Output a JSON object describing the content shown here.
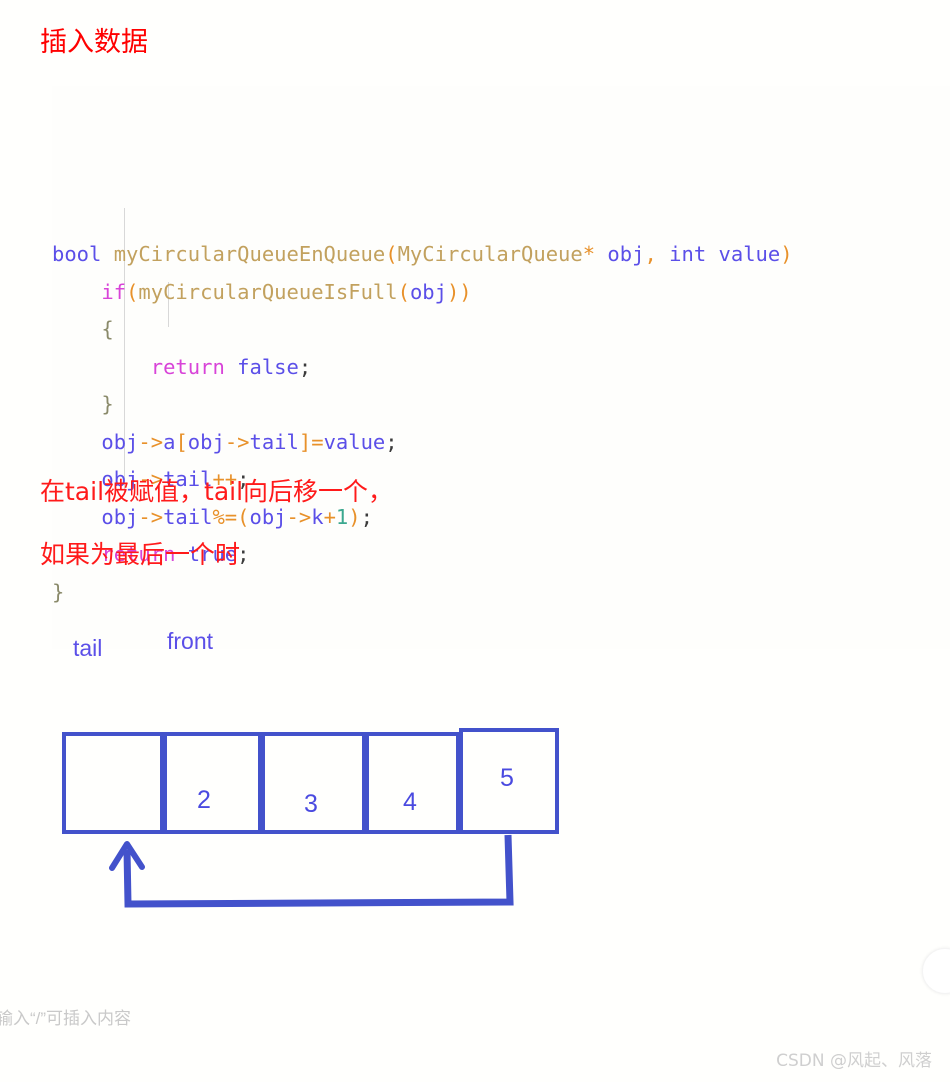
{
  "document": {
    "title": "插入数据",
    "title_color": "#FF0000"
  },
  "code": {
    "language": "c",
    "background": "#FEFEFC",
    "lines": [
      {
        "indent": 0,
        "tokens": [
          {
            "t": "bool",
            "c": "type"
          },
          {
            "t": " ",
            "c": "plain"
          },
          {
            "t": "myCircularQueueEnQueue",
            "c": "fn"
          },
          {
            "t": "(",
            "c": "punc"
          },
          {
            "t": "MyCircularQueue",
            "c": "fn"
          },
          {
            "t": "*",
            "c": "punc"
          },
          {
            "t": " ",
            "c": "plain"
          },
          {
            "t": "obj",
            "c": "var"
          },
          {
            "t": ",",
            "c": "punc"
          },
          {
            "t": " ",
            "c": "plain"
          },
          {
            "t": "int",
            "c": "type"
          },
          {
            "t": " ",
            "c": "plain"
          },
          {
            "t": "value",
            "c": "var"
          },
          {
            "t": ")",
            "c": "punc"
          }
        ]
      },
      {
        "indent": 1,
        "tokens": [
          {
            "t": "if",
            "c": "kw"
          },
          {
            "t": "(",
            "c": "punc"
          },
          {
            "t": "myCircularQueueIsFull",
            "c": "fn"
          },
          {
            "t": "(",
            "c": "punc"
          },
          {
            "t": "obj",
            "c": "var"
          },
          {
            "t": "))",
            "c": "punc"
          }
        ]
      },
      {
        "indent": 1,
        "tokens": [
          {
            "t": "{",
            "c": "brace"
          }
        ]
      },
      {
        "indent": 2,
        "tokens": [
          {
            "t": "return",
            "c": "kw"
          },
          {
            "t": " ",
            "c": "plain"
          },
          {
            "t": "false",
            "c": "lit"
          },
          {
            "t": ";",
            "c": "plain"
          }
        ]
      },
      {
        "indent": 1,
        "tokens": [
          {
            "t": "}",
            "c": "brace"
          }
        ]
      },
      {
        "indent": 1,
        "tokens": [
          {
            "t": "obj",
            "c": "var"
          },
          {
            "t": "->",
            "c": "punc"
          },
          {
            "t": "a",
            "c": "var"
          },
          {
            "t": "[",
            "c": "punc"
          },
          {
            "t": "obj",
            "c": "var"
          },
          {
            "t": "->",
            "c": "punc"
          },
          {
            "t": "tail",
            "c": "var"
          },
          {
            "t": "]",
            "c": "punc"
          },
          {
            "t": "=",
            "c": "punc"
          },
          {
            "t": "value",
            "c": "var"
          },
          {
            "t": ";",
            "c": "plain"
          }
        ]
      },
      {
        "indent": 1,
        "tokens": [
          {
            "t": "obj",
            "c": "var"
          },
          {
            "t": "->",
            "c": "punc"
          },
          {
            "t": "tail",
            "c": "var"
          },
          {
            "t": "++",
            "c": "punc"
          },
          {
            "t": ";",
            "c": "plain"
          }
        ]
      },
      {
        "indent": 1,
        "tokens": [
          {
            "t": "obj",
            "c": "var"
          },
          {
            "t": "->",
            "c": "punc"
          },
          {
            "t": "tail",
            "c": "var"
          },
          {
            "t": "%=",
            "c": "punc"
          },
          {
            "t": "(",
            "c": "punc"
          },
          {
            "t": "obj",
            "c": "var"
          },
          {
            "t": "->",
            "c": "punc"
          },
          {
            "t": "k",
            "c": "var"
          },
          {
            "t": "+",
            "c": "punc"
          },
          {
            "t": "1",
            "c": "num"
          },
          {
            "t": ")",
            "c": "punc"
          },
          {
            "t": ";",
            "c": "plain"
          }
        ]
      },
      {
        "indent": 1,
        "tokens": [
          {
            "t": "return",
            "c": "kw"
          },
          {
            "t": " ",
            "c": "plain"
          },
          {
            "t": "true",
            "c": "lit"
          },
          {
            "t": ";",
            "c": "plain"
          }
        ]
      },
      {
        "indent": 0,
        "tokens": [
          {
            "t": "}",
            "c": "brace"
          }
        ]
      }
    ]
  },
  "annotations": {
    "line1": "在tail被赋值，tail向后移一个，",
    "line2": "如果为最后一个时",
    "color": "#FF1A1A"
  },
  "diagram": {
    "pointers": {
      "tail": "tail",
      "front": "front"
    },
    "pointer_color": "#5B4FE8",
    "box_color": "#4352CB",
    "cells": [
      {
        "value": ""
      },
      {
        "value": "2"
      },
      {
        "value": "3"
      },
      {
        "value": "4"
      },
      {
        "value": "5"
      }
    ]
  },
  "editor": {
    "placeholder": "输入“/”可插入内容"
  },
  "watermark": {
    "text": "CSDN @风起、风落"
  }
}
